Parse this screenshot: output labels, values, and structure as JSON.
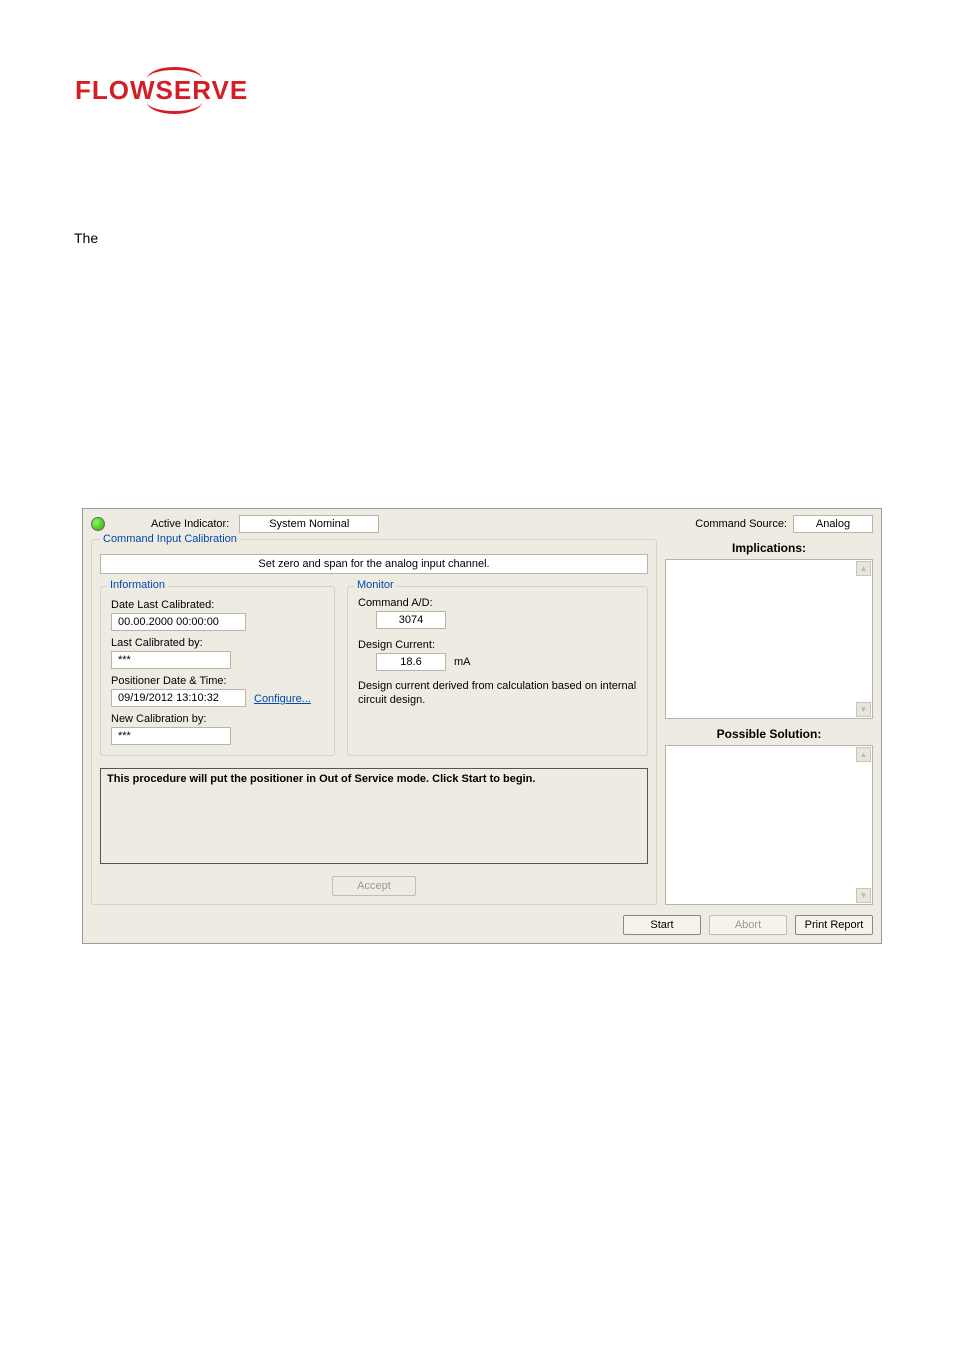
{
  "logo": {
    "text": "FLOWSERVE"
  },
  "intro_text": "The",
  "status": {
    "active_indicator_label": "Active Indicator:",
    "active_indicator_value": "System Nominal",
    "command_source_label": "Command Source:",
    "command_source_value": "Analog"
  },
  "panel": {
    "title": "Command Input Calibration",
    "instruction": "Set zero and span for the analog input channel."
  },
  "information": {
    "legend": "Information",
    "date_last_calibrated_label": "Date Last Calibrated:",
    "date_last_calibrated_value": "00.00.2000 00:00:00",
    "last_calibrated_by_label": "Last Calibrated by:",
    "last_calibrated_by_value": "***",
    "positioner_datetime_label": "Positioner Date & Time:",
    "positioner_datetime_value": "09/19/2012 13:10:32",
    "configure_link": "Configure...",
    "new_calibration_by_label": "New Calibration by:",
    "new_calibration_by_value": "***"
  },
  "monitor": {
    "legend": "Monitor",
    "command_ad_label": "Command A/D:",
    "command_ad_value": "3074",
    "design_current_label": "Design Current:",
    "design_current_value": "18.6",
    "design_current_unit": "mA",
    "note": "Design current derived from calculation based on internal circuit design."
  },
  "procedure_text": "This procedure will put the positioner in Out of Service mode.  Click Start to begin.",
  "accept_button": "Accept",
  "implications": {
    "heading": "Implications:"
  },
  "solution": {
    "heading": "Possible Solution:"
  },
  "buttons": {
    "start": "Start",
    "abort": "Abort",
    "print_report": "Print Report"
  }
}
